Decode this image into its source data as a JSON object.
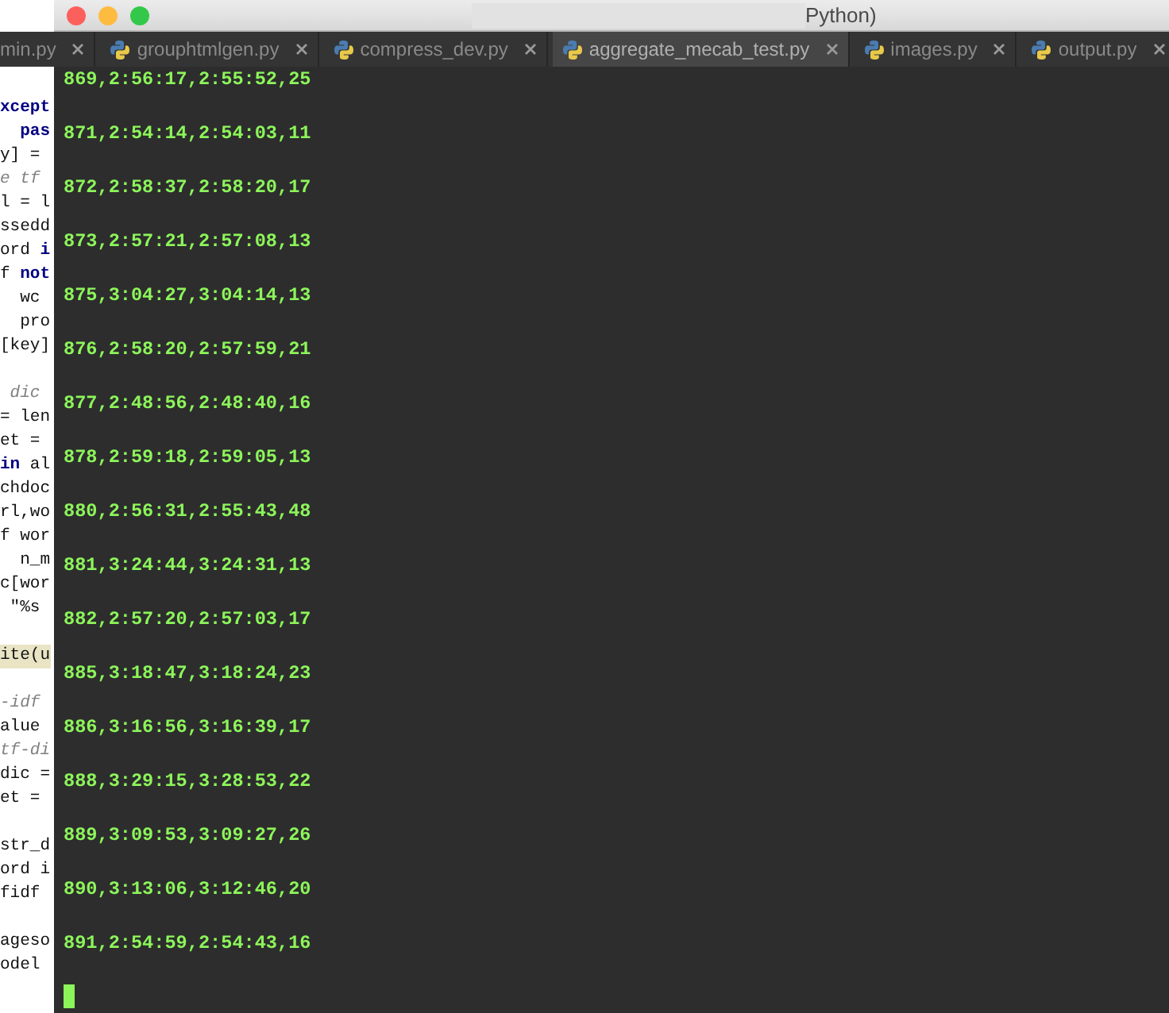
{
  "editor": {
    "tabs": [
      {
        "label": "min.py",
        "selected": false,
        "has_icon": false
      },
      {
        "label": "grouphtmlgen.py",
        "selected": false,
        "has_icon": true
      },
      {
        "label": "compress_dev.py",
        "selected": false,
        "has_icon": true
      },
      {
        "label": "aggregate_mecab_test.py",
        "selected": true,
        "has_icon": true
      },
      {
        "label": "images.py",
        "selected": false,
        "has_icon": true
      },
      {
        "label": "output.py",
        "selected": false,
        "has_icon": true
      }
    ],
    "lines": [
      {
        "kind": "blank"
      },
      {
        "kind": "code",
        "text": "**xcept**"
      },
      {
        "kind": "code",
        "text": "  **pas**"
      },
      {
        "kind": "code",
        "text": "y] ="
      },
      {
        "kind": "comment",
        "text": "e tf"
      },
      {
        "kind": "code",
        "text": "l = l"
      },
      {
        "kind": "code",
        "text": "ssedd"
      },
      {
        "kind": "code",
        "text": "ord **i**"
      },
      {
        "kind": "code",
        "text": "f **not**"
      },
      {
        "kind": "code",
        "text": "  wc"
      },
      {
        "kind": "code",
        "text": "  pro"
      },
      {
        "kind": "code",
        "text": "[key]"
      },
      {
        "kind": "blank"
      },
      {
        "kind": "comment",
        "text": " dic"
      },
      {
        "kind": "code",
        "text": "= len"
      },
      {
        "kind": "code",
        "text": "et ="
      },
      {
        "kind": "code",
        "text": "**in** al"
      },
      {
        "kind": "code",
        "text": "chdoc"
      },
      {
        "kind": "code",
        "text": "rl,wo"
      },
      {
        "kind": "code",
        "text": "f wor"
      },
      {
        "kind": "code",
        "text": "  n_m"
      },
      {
        "kind": "code",
        "text": "c[wor"
      },
      {
        "kind": "code",
        "text": " \"%s"
      },
      {
        "kind": "blank"
      },
      {
        "kind": "highlight",
        "text": "ite(u"
      },
      {
        "kind": "blank"
      },
      {
        "kind": "comment",
        "text": "-idf"
      },
      {
        "kind": "code",
        "text": "alue"
      },
      {
        "kind": "comment",
        "text": "tf-di"
      },
      {
        "kind": "code",
        "text": "dic ="
      },
      {
        "kind": "code",
        "text": "et ="
      },
      {
        "kind": "blank"
      },
      {
        "kind": "code",
        "text": "str_d"
      },
      {
        "kind": "code",
        "text": "ord i"
      },
      {
        "kind": "code",
        "text": "fidf"
      },
      {
        "kind": "blank"
      },
      {
        "kind": "code",
        "text": "ageso"
      },
      {
        "kind": "code",
        "text": "odel"
      }
    ]
  },
  "terminal": {
    "title": "Python)",
    "cursor": true,
    "lines": [
      "869,2:56:17,2:55:52,25",
      "871,2:54:14,2:54:03,11",
      "872,2:58:37,2:58:20,17",
      "873,2:57:21,2:57:08,13",
      "875,3:04:27,3:04:14,13",
      "876,2:58:20,2:57:59,21",
      "877,2:48:56,2:48:40,16",
      "878,2:59:18,2:59:05,13",
      "880,2:56:31,2:55:43,48",
      "881,3:24:44,3:24:31,13",
      "882,2:57:20,2:57:03,17",
      "885,3:18:47,3:18:24,23",
      "886,3:16:56,3:16:39,17",
      "888,3:29:15,3:28:53,22",
      "889,3:09:53,3:09:27,26",
      "890,3:13:06,3:12:46,20",
      "891,2:54:59,2:54:43,16"
    ]
  }
}
